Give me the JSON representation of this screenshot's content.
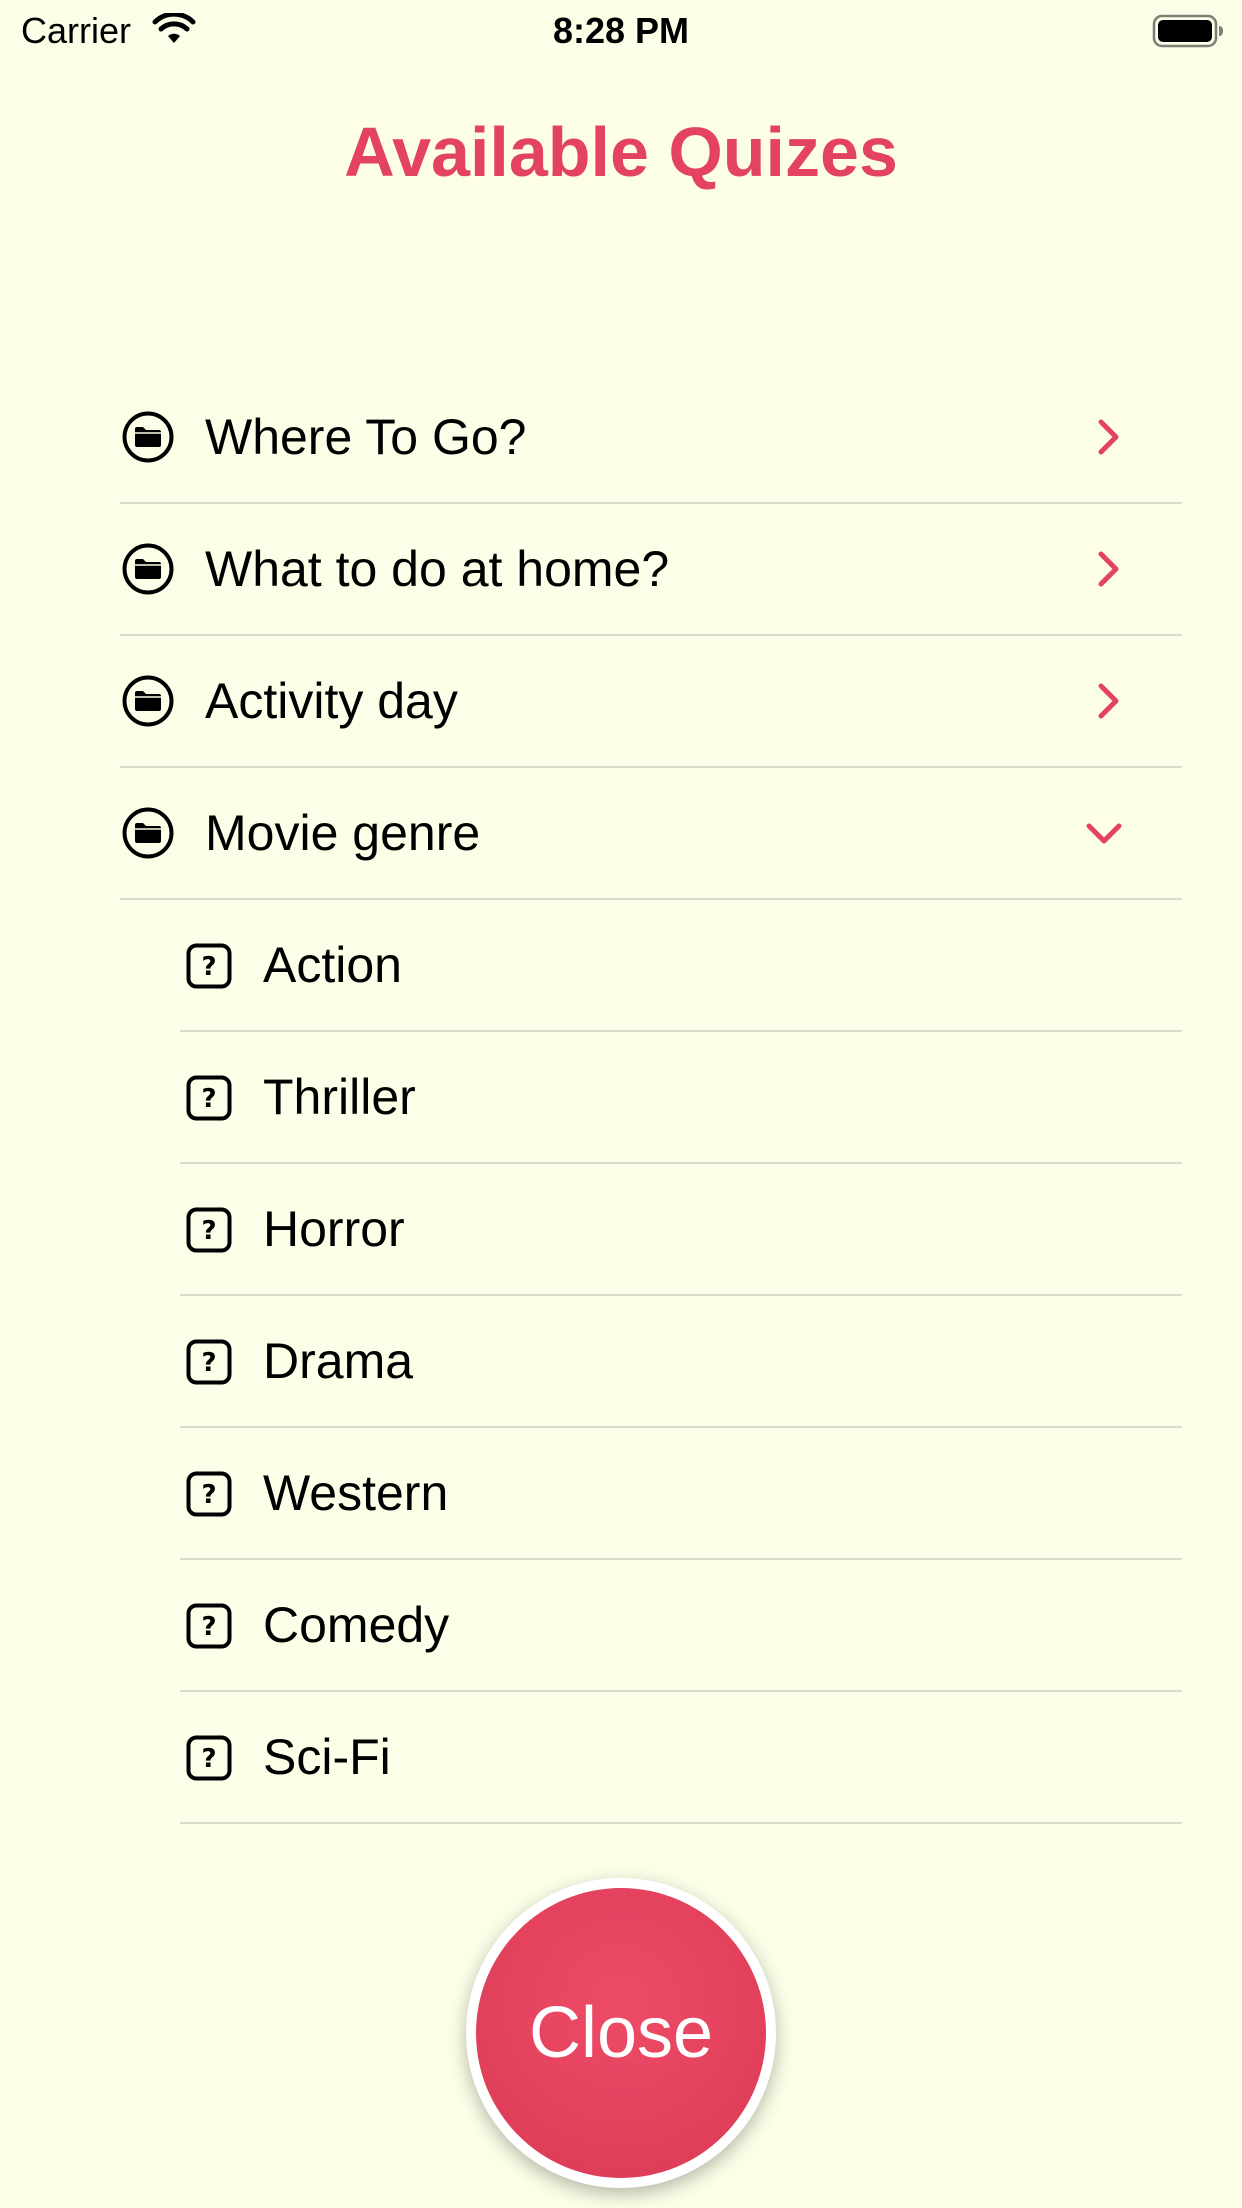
{
  "status_bar": {
    "carrier": "Carrier",
    "time": "8:28 PM"
  },
  "title": "Available Quizes",
  "categories": [
    {
      "label": "Where To Go?",
      "expanded": false
    },
    {
      "label": "What to do at home?",
      "expanded": false
    },
    {
      "label": "Activity day",
      "expanded": false
    },
    {
      "label": "Movie genre",
      "expanded": true
    }
  ],
  "movie_genres": [
    "Action",
    "Thriller",
    "Horror",
    "Drama",
    "Western",
    "Comedy",
    "Sci-Fi"
  ],
  "close_button": {
    "label": "Close"
  },
  "colors": {
    "background": "#FCFEE8",
    "accent": "#E3435E",
    "separator": "#D9DBCB"
  },
  "icons": {
    "category": "folder-icon",
    "item": "question-icon",
    "collapsed": "chevron-right-icon",
    "expanded": "chevron-down-icon"
  }
}
